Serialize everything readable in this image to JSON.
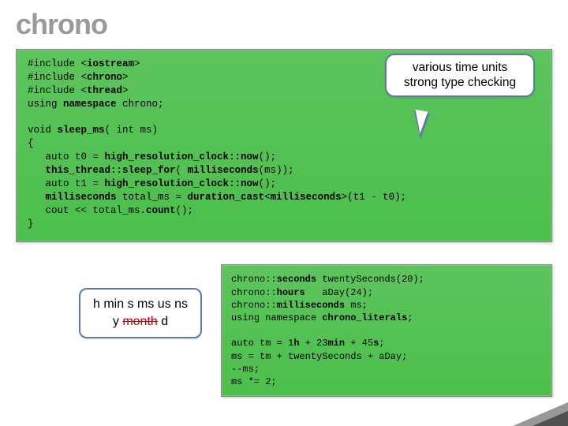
{
  "title": "chrono",
  "callout": {
    "line1": "various time units",
    "line2": "strong type checking"
  },
  "code_main": {
    "l1a": "#include <",
    "l1b": "iostream",
    "l1c": ">",
    "l2a": "#include <",
    "l2b": "chrono",
    "l2c": ">",
    "l3a": "#include <",
    "l3b": "thread",
    "l3c": ">",
    "l4a": "using ",
    "l4b": "namespace",
    "l4c": " chrono;",
    "blank1": "",
    "l5a": "void ",
    "l5b": "sleep_ms",
    "l5c": "( int ms)",
    "l6": "{",
    "l7a": "   auto t0 = ",
    "l7b": "high_resolution_clock::now",
    "l7c": "();",
    "l8a": "   ",
    "l8b": "this_thread::sleep_for",
    "l8c": "( ",
    "l8d": "milliseconds",
    "l8e": "(ms));",
    "l9a": "   auto t1 = ",
    "l9b": "high_resolution_clock::now",
    "l9c": "();",
    "l10a": "   ",
    "l10b": "milliseconds",
    "l10c": " total_ms = ",
    "l10d": "duration_cast",
    "l10e": "<",
    "l10f": "milliseconds",
    "l10g": ">(t1 - t0);",
    "l11a": "   cout << total_ms.",
    "l11b": "count",
    "l11c": "();",
    "l12": "}"
  },
  "units": {
    "line1_a": "h min s ms us ns",
    "line2_a": "y ",
    "line2_strike": "month",
    "line2_c": " d"
  },
  "code_small": {
    "s1a": "chrono::",
    "s1b": "seconds",
    "s1c": " twentySeconds(20);",
    "s2a": "chrono::",
    "s2b": "hours",
    "s2c": "   aDay(24);",
    "s3a": "chrono::",
    "s3b": "milliseconds",
    "s3c": " ms;",
    "s4a": "using namespace ",
    "s4b": "chrono_literals",
    "s4c": ";",
    "blank": "",
    "s5a": "auto tm = 1",
    "s5b": "h",
    "s5c": " + 23",
    "s5d": "min",
    "s5e": " + 45",
    "s5f": "s",
    "s5g": ";",
    "s6": "ms = tm + twentySeconds + aDay;",
    "s7": "--ms;",
    "s8": "ms *= 2;"
  }
}
